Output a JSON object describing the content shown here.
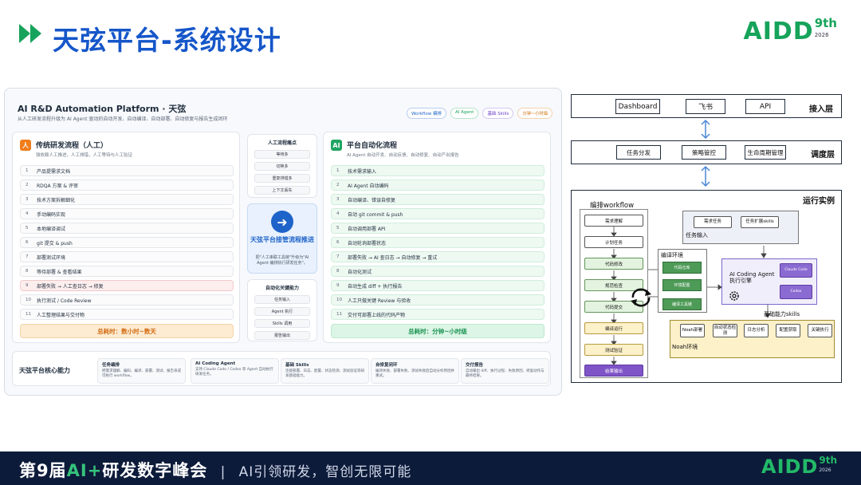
{
  "header": {
    "title": "天弦平台-系统设计",
    "logo_text": "AIDD",
    "logo_sup": "9th",
    "logo_year": "2026"
  },
  "card": {
    "title": "AI R&D Automation Platform · 天弦",
    "subtitle": "从人工研发流程升级为 AI Agent 驱动的自动开发、自动编译、自动部署、自动修复与报告生成闭环",
    "pills": [
      "Workflow 编排",
      "AI Agent",
      "基础 Skills",
      "分钟~小时级"
    ]
  },
  "traditional": {
    "icon": "人",
    "title": "传统研发流程（人工）",
    "subtitle": "强依赖人工推进，人工排错，人工等待与人工验证",
    "steps": [
      {
        "num": "1",
        "label": "产品提需求文档"
      },
      {
        "num": "2",
        "label": "RDQA 方案 & 评审"
      },
      {
        "num": "3",
        "label": "技术方案拆解细化"
      },
      {
        "num": "4",
        "label": "手动编码实现"
      },
      {
        "num": "5",
        "label": "本地编译调试"
      },
      {
        "num": "6",
        "label": "git 提交 & push"
      },
      {
        "num": "7",
        "label": "部署测试环境"
      },
      {
        "num": "8",
        "label": "等待部署 & 查看结果"
      },
      {
        "num": "9",
        "label": "部署失败 → 人工查日志 → 修复"
      },
      {
        "num": "10",
        "label": "执行测试 / Code Review"
      },
      {
        "num": "11",
        "label": "人工整理结果与交付物"
      }
    ],
    "total": "总耗时：数小时~数天"
  },
  "middle": {
    "pain_title": "人工流程痛点",
    "pain_items": [
      "等待多",
      "切换多",
      "重复排错多",
      "上下文丢失"
    ],
    "center_title": "天弦平台接管流程推进",
    "center_desc": "把\"人工串联工具链\"升级为\"AI Agent 编排执行研发任务\"。",
    "auto_title": "自动化关键能力",
    "auto_items": [
      "任务输入",
      "Agent 执行",
      "Skills 调用",
      "报告输出"
    ]
  },
  "automation": {
    "icon": "AI",
    "title": "平台自动化流程",
    "subtitle": "AI Agent 自动开发、自动反馈、自动修复、自动产出报告",
    "steps": [
      {
        "num": "1",
        "label": "技术需求输入"
      },
      {
        "num": "2",
        "label": "AI Agent 自动编码"
      },
      {
        "num": "3",
        "label": "自动编译、错误自修复"
      },
      {
        "num": "4",
        "label": "自动 git commit & push"
      },
      {
        "num": "5",
        "label": "自动调用部署 API"
      },
      {
        "num": "6",
        "label": "自动轮询部署状态"
      },
      {
        "num": "7",
        "label": "部署失败 → AI 查日志 → 自动修复 → 重试"
      },
      {
        "num": "8",
        "label": "自动化测试"
      },
      {
        "num": "9",
        "label": "自动生成 diff + 执行报告"
      },
      {
        "num": "10",
        "label": "人工只做关键 Review 与验收"
      },
      {
        "num": "11",
        "label": "交付可部署上线的代码产物"
      }
    ],
    "total": "总耗时：分钟~小时级"
  },
  "capabilities": {
    "title": "天弦平台核心能力",
    "items": [
      {
        "title": "任务编排",
        "desc": "把需求理解、编码、编译、部署、测试、报告串成可执行 workflow。"
      },
      {
        "title": "AI Coding Agent",
        "desc": "支持 Claude Code / Codex 等 Agent 自动执行研发任务。"
      },
      {
        "title": "基础 Skills",
        "desc": "连接部署、日志、配置、状态检测、测试验证等研发基础能力。"
      },
      {
        "title": "自修复闭环",
        "desc": "编译失败、部署失败、测试失败后自动分析原因并重试。"
      },
      {
        "title": "交付报告",
        "desc": "自动输出 diff、执行过程、失败原因、修复动作与最终结果。"
      }
    ]
  },
  "diagram": {
    "access_layer": {
      "label": "接入层",
      "items": [
        "Dashboard",
        "飞书",
        "API"
      ]
    },
    "dispatch_layer": {
      "label": "调度层",
      "items": [
        "任务分发",
        "策略管控",
        "生命周期管理"
      ]
    },
    "runtime": {
      "label": "运行实例",
      "workflow_label": "编排workflow",
      "workflow_nodes": [
        "需求理解",
        "计划任务",
        "代码修改",
        "规范检查",
        "代码提交",
        "编译运行",
        "测试验证",
        "结果输出"
      ],
      "task_input_label": "任务输入",
      "task_input_items": [
        "需求任务",
        "任务扩展skills"
      ],
      "env_label": "编译环境",
      "env_items": [
        "代码仓库",
        "环境配置",
        "编译工具链"
      ],
      "agent_title": "AI Coding Agent",
      "agent_sub": "执行引擎",
      "agent_items": [
        "Claude Code",
        "Codex"
      ],
      "skills_label": "基础能力skills",
      "noah_label": "Noah环境",
      "noah_items": [
        "Noah部署",
        "自动状态检测",
        "日志分析",
        "配置获取",
        "关键执行"
      ]
    }
  },
  "footer": {
    "prefix": "第9届",
    "ai": "AI+",
    "suffix": "研发数字峰会",
    "sep": "|",
    "slogan": "AI引领研发，智创无限可能",
    "logo_text": "AIDD",
    "logo_sup": "9th",
    "logo_year": "2026"
  },
  "colors": {
    "title_blue": "#1556c9",
    "brand_green": "#16a35a",
    "traditional_orange": "#ef7d1a",
    "automation_green": "#22a563",
    "footer_bg": "#0d1b3a"
  }
}
